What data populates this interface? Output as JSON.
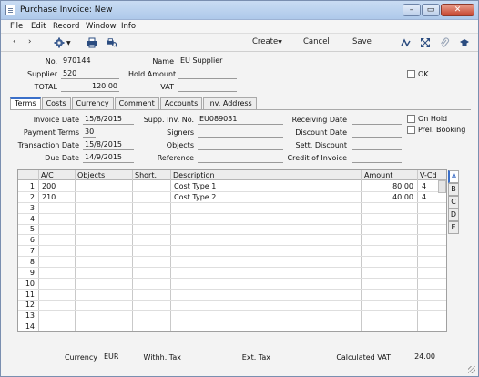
{
  "window": {
    "title": "Purchase Invoice: New"
  },
  "menu": [
    "File",
    "Edit",
    "Record",
    "Window",
    "Info"
  ],
  "toolbar": {
    "create": "Create",
    "cancel": "Cancel",
    "save": "Save"
  },
  "header": {
    "no_label": "No.",
    "no_value": "970144",
    "name_label": "Name",
    "name_value": "EU Supplier",
    "supplier_label": "Supplier",
    "supplier_value": "520",
    "hold_label": "Hold Amount",
    "hold_value": "",
    "ok_label": "OK",
    "total_label": "TOTAL",
    "total_value": "120.00",
    "vat_label": "VAT",
    "vat_value": ""
  },
  "tabs": [
    "Terms",
    "Costs",
    "Currency",
    "Comment",
    "Accounts",
    "Inv. Address"
  ],
  "terms": {
    "invoice_date_label": "Invoice Date",
    "invoice_date": "15/8/2015",
    "payment_terms_label": "Payment Terms",
    "payment_terms": "30",
    "transaction_date_label": "Transaction Date",
    "transaction_date": "15/8/2015",
    "due_date_label": "Due Date",
    "due_date": "14/9/2015",
    "supp_inv_label": "Supp. Inv. No.",
    "supp_inv": "EU089031",
    "signers_label": "Signers",
    "signers": "",
    "objects_label": "Objects",
    "objects": "",
    "reference_label": "Reference",
    "reference": "",
    "receiving_date_label": "Receiving Date",
    "receiving_date": "",
    "discount_date_label": "Discount Date",
    "discount_date": "",
    "sett_discount_label": "Sett. Discount",
    "sett_discount": "",
    "credit_invoice_label": "Credit of Invoice",
    "credit_invoice": "",
    "on_hold_label": "On Hold",
    "prel_booking_label": "Prel. Booking"
  },
  "grid": {
    "columns": [
      "A/C",
      "Objects",
      "Short.",
      "Description",
      "Amount",
      "V-Cd"
    ],
    "rows": [
      {
        "n": "1",
        "ac": "200",
        "objects": "",
        "short": "",
        "desc": "Cost Type 1",
        "amount": "80.00",
        "vcd": "4"
      },
      {
        "n": "2",
        "ac": "210",
        "objects": "",
        "short": "",
        "desc": "Cost Type 2",
        "amount": "40.00",
        "vcd": "4"
      },
      {
        "n": "3",
        "ac": "",
        "objects": "",
        "short": "",
        "desc": "",
        "amount": "",
        "vcd": ""
      },
      {
        "n": "4",
        "ac": "",
        "objects": "",
        "short": "",
        "desc": "",
        "amount": "",
        "vcd": ""
      },
      {
        "n": "5",
        "ac": "",
        "objects": "",
        "short": "",
        "desc": "",
        "amount": "",
        "vcd": ""
      },
      {
        "n": "6",
        "ac": "",
        "objects": "",
        "short": "",
        "desc": "",
        "amount": "",
        "vcd": ""
      },
      {
        "n": "7",
        "ac": "",
        "objects": "",
        "short": "",
        "desc": "",
        "amount": "",
        "vcd": ""
      },
      {
        "n": "8",
        "ac": "",
        "objects": "",
        "short": "",
        "desc": "",
        "amount": "",
        "vcd": ""
      },
      {
        "n": "9",
        "ac": "",
        "objects": "",
        "short": "",
        "desc": "",
        "amount": "",
        "vcd": ""
      },
      {
        "n": "10",
        "ac": "",
        "objects": "",
        "short": "",
        "desc": "",
        "amount": "",
        "vcd": ""
      },
      {
        "n": "11",
        "ac": "",
        "objects": "",
        "short": "",
        "desc": "",
        "amount": "",
        "vcd": ""
      },
      {
        "n": "12",
        "ac": "",
        "objects": "",
        "short": "",
        "desc": "",
        "amount": "",
        "vcd": ""
      },
      {
        "n": "13",
        "ac": "",
        "objects": "",
        "short": "",
        "desc": "",
        "amount": "",
        "vcd": ""
      },
      {
        "n": "14",
        "ac": "",
        "objects": "",
        "short": "",
        "desc": "",
        "amount": "",
        "vcd": ""
      }
    ],
    "side_tabs": [
      "A",
      "B",
      "C",
      "D",
      "E"
    ]
  },
  "footer": {
    "currency_label": "Currency",
    "currency": "EUR",
    "withh_label": "Withh. Tax",
    "withh": "",
    "ext_label": "Ext. Tax",
    "ext": "",
    "calc_vat_label": "Calculated VAT",
    "calc_vat": "24.00"
  },
  "colors": {
    "accent": "#3a6fc9",
    "titlebar": "#b9d1ee",
    "close": "#c6452f"
  },
  "icons": [
    "document-icon",
    "minimize-icon",
    "maximize-icon",
    "close-icon",
    "back-icon",
    "forward-icon",
    "gear-icon",
    "printer-icon",
    "print-preview-icon",
    "signature-icon",
    "expand-icon",
    "attachment-icon",
    "mortarboard-icon"
  ]
}
